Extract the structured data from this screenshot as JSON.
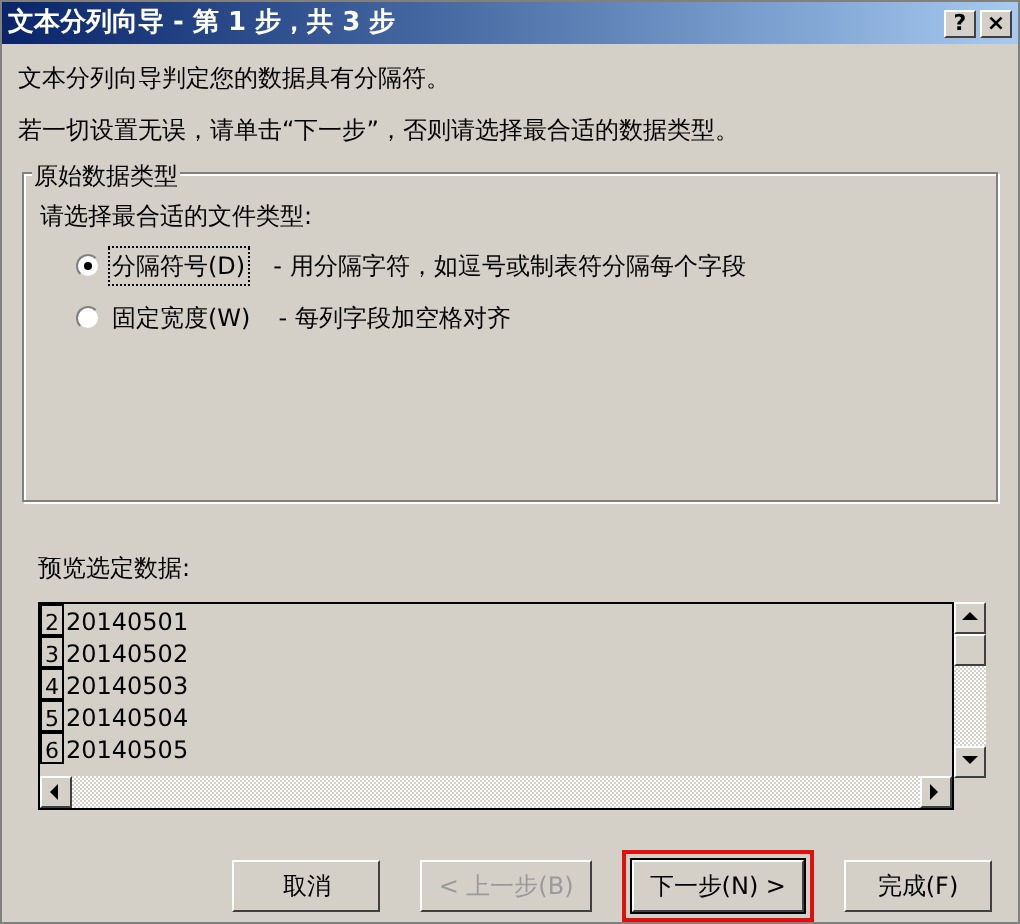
{
  "window": {
    "title": "文本分列向导 - 第 1 步，共 3 步",
    "controls": [
      "?",
      "×"
    ]
  },
  "intro": [
    "文本分列向导判定您的数据具有分隔符。",
    "若一切设置无误，请单击“下一步”，否则请选择最合适的数据类型。"
  ],
  "group": {
    "title": "原始数据类型",
    "prompt": "请选择最合适的文件类型:",
    "options": [
      {
        "label": "分隔符号(D)",
        "description": "- 用分隔字符，如逗号或制表符分隔每个字段",
        "selected": true
      },
      {
        "label": "固定宽度(W)",
        "description": "- 每列字段加空格对齐",
        "selected": false
      }
    ]
  },
  "preview": {
    "label": "预览选定数据:",
    "rows": [
      {
        "number": "2",
        "value": "20140501"
      },
      {
        "number": "3",
        "value": "20140502"
      },
      {
        "number": "4",
        "value": "20140503"
      },
      {
        "number": "5",
        "value": "20140504"
      },
      {
        "number": "6",
        "value": "20140505"
      }
    ]
  },
  "buttons": [
    {
      "label": "取消",
      "disabled": false,
      "highlighted": false
    },
    {
      "label": "< 上一步(B)",
      "disabled": true,
      "highlighted": false
    },
    {
      "label": "下一步(N) >",
      "disabled": false,
      "highlighted": true
    },
    {
      "label": "完成(F)",
      "disabled": false,
      "highlighted": false
    }
  ]
}
